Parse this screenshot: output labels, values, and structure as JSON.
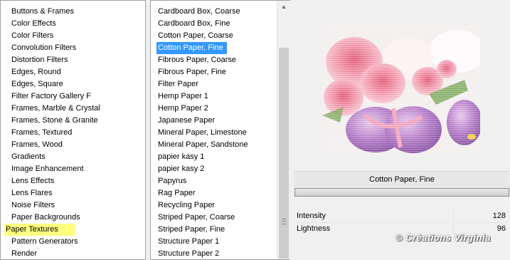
{
  "categories": {
    "items": [
      "Buttons & Frames",
      "Color Effects",
      "Color Filters",
      "Convolution Filters",
      "Distortion Filters",
      "Edges, Round",
      "Edges, Square",
      "Filter Factory Gallery F",
      "Frames, Marble & Crystal",
      "Frames, Stone & Granite",
      "Frames, Textured",
      "Frames, Wood",
      "Gradients",
      "Image Enhancement",
      "Lens Effects",
      "Lens Flares",
      "Noise Filters",
      "Paper Backgrounds",
      "Paper Textures",
      "Pattern Generators",
      "Render"
    ],
    "selected": "Paper Textures",
    "highlight_color": "#ffff80"
  },
  "filters": {
    "items": [
      "Cardboard Box, Coarse",
      "Cardboard Box, Fine",
      "Cotton Paper, Coarse",
      "Cotton Paper, Fine",
      "Fibrous Paper, Coarse",
      "Fibrous Paper, Fine",
      "Filter Paper",
      "Hemp Paper 1",
      "Hemp Paper 2",
      "Japanese Paper",
      "Mineral Paper, Limestone",
      "Mineral Paper, Sandstone",
      "papier kasy 1",
      "papier kasy 2",
      "Papyrus",
      "Rag Paper",
      "Recycling Paper",
      "Striped Paper, Coarse",
      "Striped Paper, Fine",
      "Structure Paper 1",
      "Structure Paper 2"
    ],
    "selected": "Cotton Paper, Fine",
    "highlight_color": "#3399ff"
  },
  "scrollbar": {
    "up_icon": "scroll-up-arrow-icon",
    "grip_icon": "scroll-grip-icon"
  },
  "preview": {
    "label": "Cotton Paper, Fine"
  },
  "params": [
    {
      "name": "Intensity",
      "value": "128"
    },
    {
      "name": "Lightness",
      "value": "96"
    }
  ],
  "watermark": "© Créations Virginia"
}
